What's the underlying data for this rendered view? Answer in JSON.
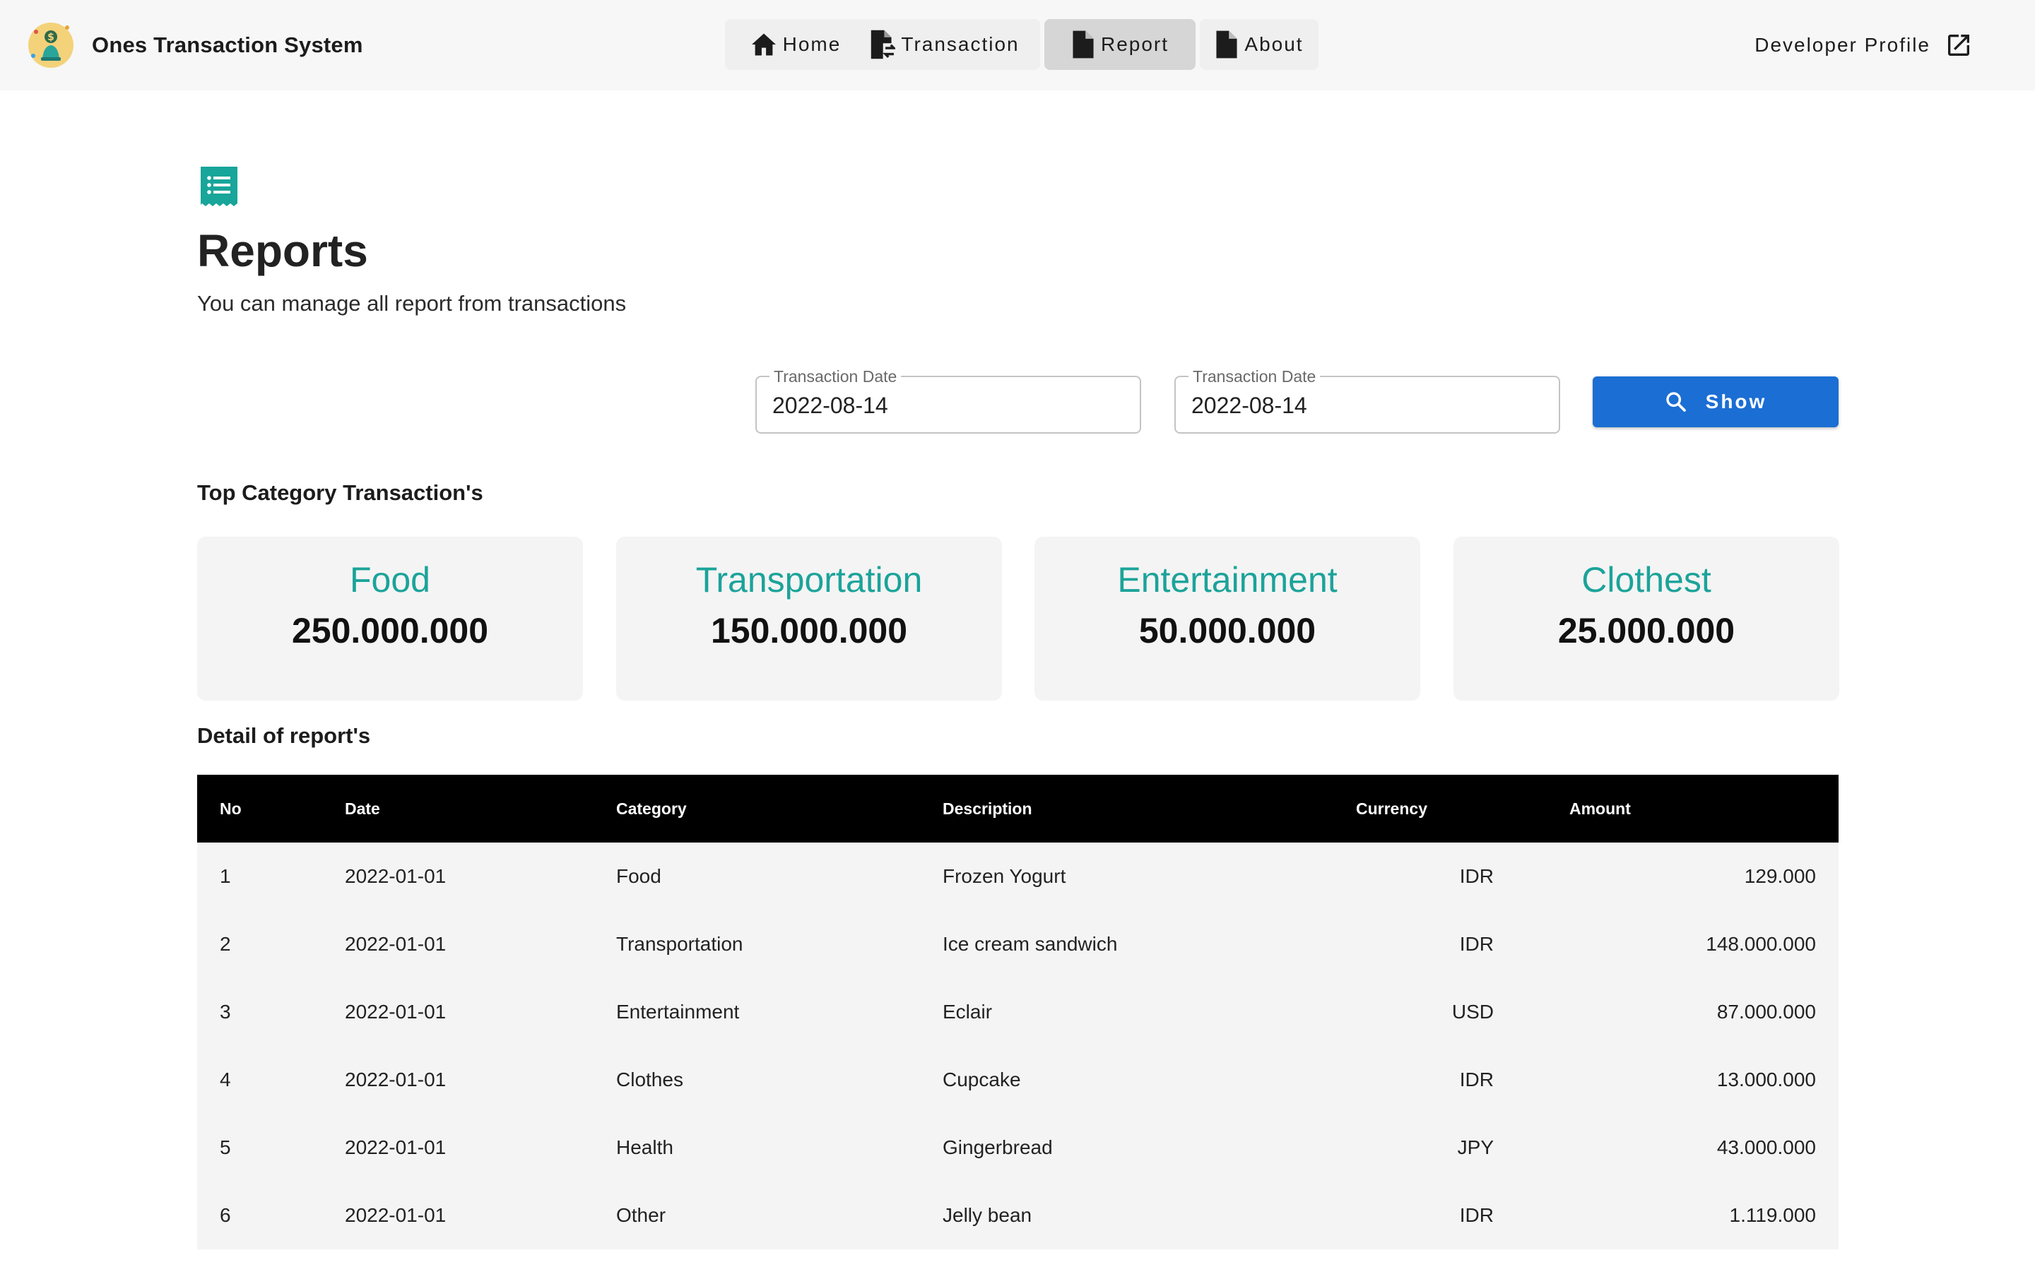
{
  "app": {
    "title": "Ones Transaction System"
  },
  "nav": {
    "home": "Home",
    "transaction": "Transaction",
    "report": "Report",
    "about": "About",
    "developer_profile": "Developer Profile"
  },
  "header": {
    "title": "Reports",
    "subtitle": "You can manage all report from transactions"
  },
  "filter": {
    "start": {
      "label": "Transaction Date",
      "value": "2022-08-14"
    },
    "end": {
      "label": "Transaction Date",
      "value": "2022-08-14"
    },
    "show_label": "Show"
  },
  "top_categories": {
    "title": "Top Category Transaction's",
    "items": [
      {
        "category": "Food",
        "amount": "250.000.000"
      },
      {
        "category": "Transportation",
        "amount": "150.000.000"
      },
      {
        "category": "Entertainment",
        "amount": "50.000.000"
      },
      {
        "category": "Clothest",
        "amount": "25.000.000"
      }
    ]
  },
  "detail": {
    "title": "Detail of report's",
    "columns": {
      "no": "No",
      "date": "Date",
      "category": "Category",
      "description": "Description",
      "currency": "Currency",
      "amount": "Amount"
    },
    "rows": [
      {
        "no": "1",
        "date": "2022-01-01",
        "category": "Food",
        "description": "Frozen Yogurt",
        "currency": "IDR",
        "amount": "129.000"
      },
      {
        "no": "2",
        "date": "2022-01-01",
        "category": "Transportation",
        "description": "Ice cream sandwich",
        "currency": "IDR",
        "amount": "148.000.000"
      },
      {
        "no": "3",
        "date": "2022-01-01",
        "category": "Entertainment",
        "description": "Eclair",
        "currency": "USD",
        "amount": "87.000.000"
      },
      {
        "no": "4",
        "date": "2022-01-01",
        "category": "Clothes",
        "description": "Cupcake",
        "currency": "IDR",
        "amount": "13.000.000"
      },
      {
        "no": "5",
        "date": "2022-01-01",
        "category": "Health",
        "description": "Gingerbread",
        "currency": "JPY",
        "amount": "43.000.000"
      },
      {
        "no": "6",
        "date": "2022-01-01",
        "category": "Other",
        "description": "Jelly bean",
        "currency": "IDR",
        "amount": "1.119.000"
      }
    ]
  },
  "colors": {
    "accent": "#1ba39a",
    "primary_button": "#1b6ed3",
    "table_header": "#000000",
    "card_bg": "#f4f4f4"
  },
  "icons": {
    "logo": "money-person-logo",
    "home": "home-icon",
    "transaction": "file-exchange-icon",
    "report": "file-icon",
    "about": "file-icon",
    "external": "open-in-new-icon",
    "page": "receipt-icon",
    "search": "search-icon"
  }
}
